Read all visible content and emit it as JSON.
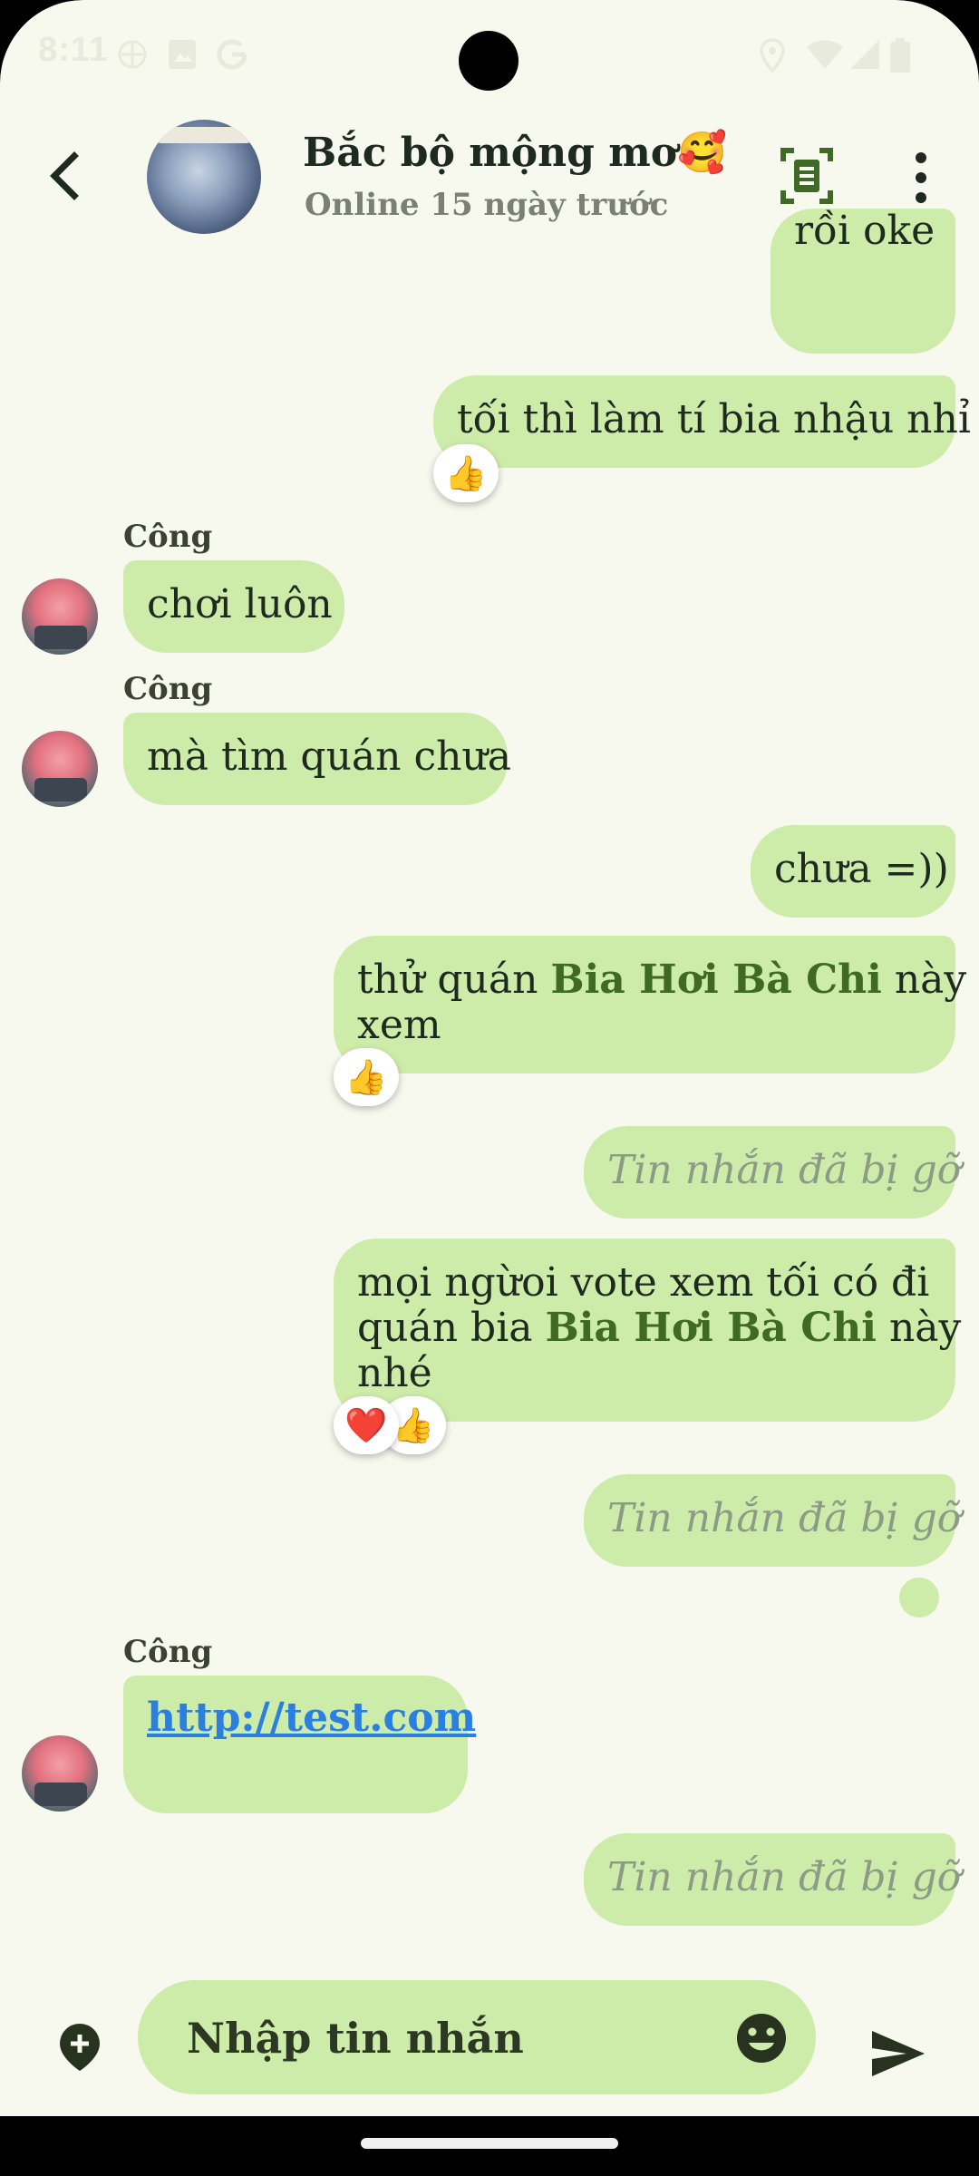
{
  "status_bar": {
    "time": "8:11",
    "icons": [
      "vpn-icon",
      "photo-icon",
      "google-icon",
      "location-icon",
      "wifi-icon",
      "signal-icon",
      "battery-icon"
    ]
  },
  "header": {
    "title": "Bắc bộ mộng mơ🥰",
    "subtitle": "Online 15 ngày trước",
    "icons": [
      "back-arrow-icon",
      "notes-icon",
      "more-vertical-icon"
    ]
  },
  "messages": [
    {
      "id": "m1",
      "direction": "out",
      "text": "rồi oke"
    },
    {
      "id": "m2",
      "direction": "out",
      "text": "tối thì làm tí bia nhậu nhỉ",
      "reactions": [
        "👍"
      ]
    },
    {
      "id": "m3",
      "direction": "in",
      "sender": "Công",
      "text": "chơi luôn"
    },
    {
      "id": "m4",
      "direction": "in",
      "sender": "Công",
      "text": "mà tìm quán chưa"
    },
    {
      "id": "m5",
      "direction": "out",
      "text": "chưa =))"
    },
    {
      "id": "m6",
      "direction": "out",
      "line1_prefix": "thử quán ",
      "place": "Bia Hơi Bà Chi",
      "line1_suffix": " này",
      "line2": "xem",
      "reactions": [
        "👍"
      ]
    },
    {
      "id": "m7",
      "direction": "out",
      "deleted": true,
      "text": "Tin nhắn đã bị gỡ"
    },
    {
      "id": "m8",
      "direction": "out",
      "line1": "mọi ngừoi vote xem tối có đi",
      "line2_prefix": "quán bia ",
      "place": "Bia Hơi Bà Chi",
      "line2_suffix": " này",
      "line3": "nhé",
      "reactions": [
        "❤️",
        "👍"
      ]
    },
    {
      "id": "m9",
      "direction": "out",
      "deleted": true,
      "text": "Tin nhắn đã bị gỡ"
    },
    {
      "id": "m10",
      "direction": "in",
      "sender": "Công",
      "link": "http://test.com"
    },
    {
      "id": "m11",
      "direction": "out",
      "deleted": true,
      "text": "Tin nhắn đã bị gỡ"
    }
  ],
  "composer": {
    "placeholder": "Nhập tin nhắn",
    "icons": [
      "attach-location-icon",
      "emoji-icon",
      "send-icon"
    ]
  },
  "colors": {
    "background": "#f7f8ee",
    "bubble": "#cdeca9",
    "accent": "#3e6a25",
    "link": "#2a7fe0",
    "deleted_text": "#8c9b86"
  }
}
